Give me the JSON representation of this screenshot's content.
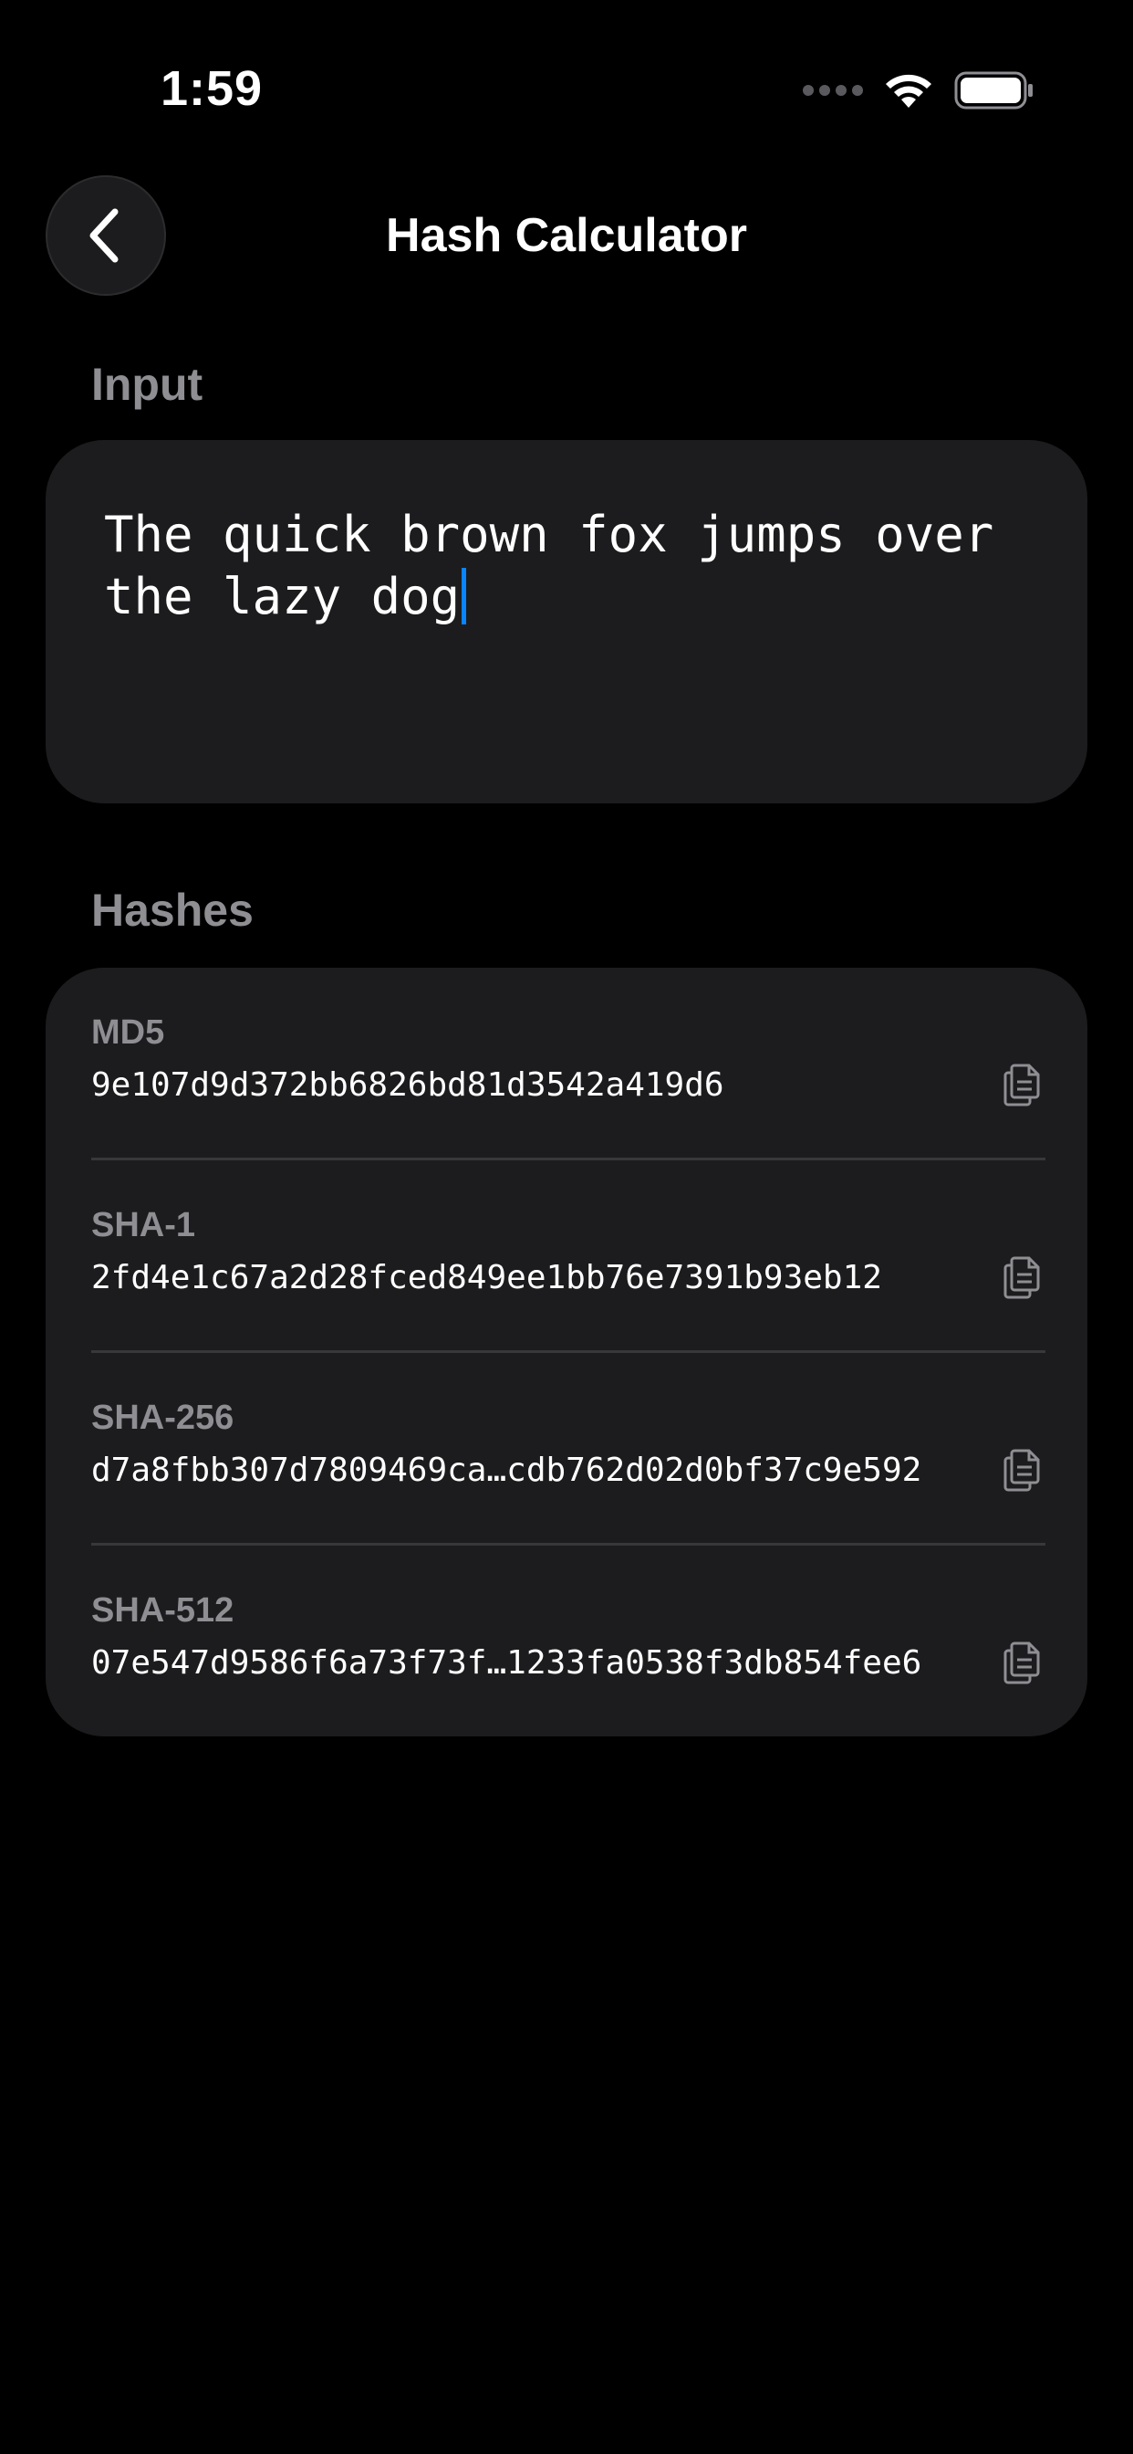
{
  "status_bar": {
    "time": "1:59"
  },
  "nav": {
    "title": "Hash Calculator",
    "back_icon": "chevron-left-icon"
  },
  "input_section": {
    "label": "Input",
    "value": "The quick brown fox jumps over the lazy dog"
  },
  "hashes_section": {
    "label": "Hashes",
    "rows": [
      {
        "algorithm": "MD5",
        "value": "9e107d9d372bb6826bd81d3542a419d6"
      },
      {
        "algorithm": "SHA-1",
        "value": "2fd4e1c67a2d28fced849ee1bb76e7391b93eb12"
      },
      {
        "algorithm": "SHA-256",
        "value": "d7a8fbb307d7809469ca…cdb762d02d0bf37c9e592"
      },
      {
        "algorithm": "SHA-512",
        "value": "07e547d9586f6a73f73f…1233fa0538f3db854fee6"
      }
    ]
  },
  "colors": {
    "background": "#000000",
    "card": "#1c1c1e",
    "secondary_text": "#8e8e93",
    "caret": "#0a84ff"
  }
}
